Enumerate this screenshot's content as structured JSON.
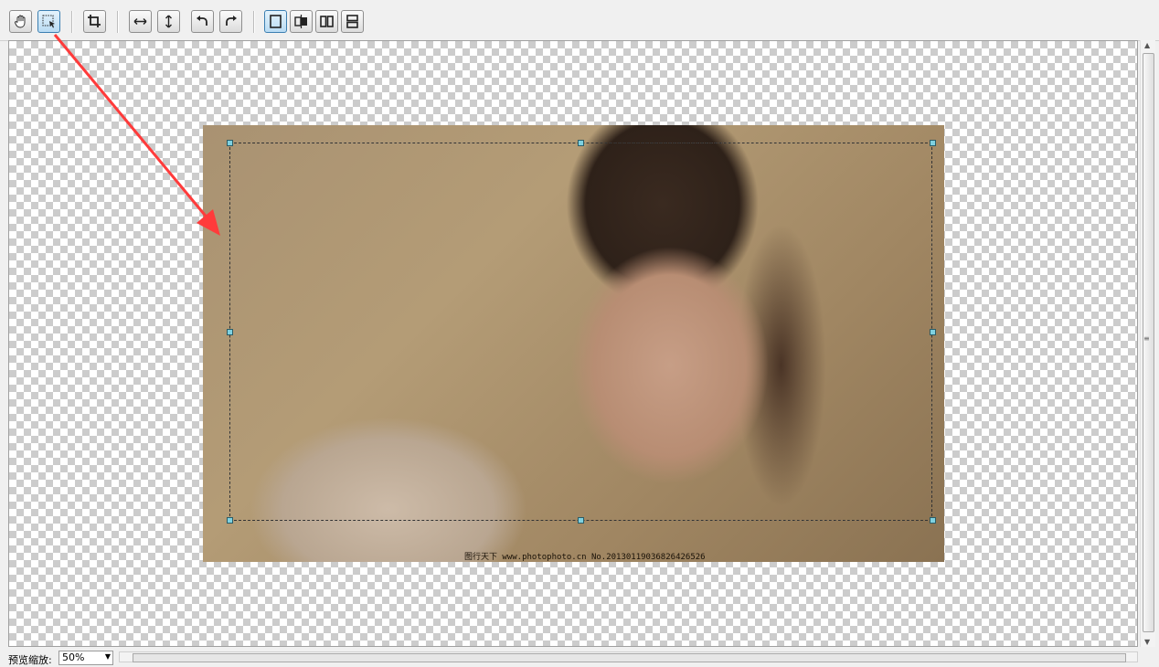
{
  "toolbar": {
    "buttons": [
      {
        "name": "hand-tool",
        "icon": "hand-icon",
        "active": false
      },
      {
        "name": "select-tool",
        "icon": "selection-icon",
        "active": true
      },
      {
        "name": "crop",
        "icon": "crop-icon",
        "active": false
      },
      {
        "name": "flip-horizontal",
        "icon": "flip-horizontal-icon",
        "active": false
      },
      {
        "name": "flip-vertical",
        "icon": "flip-vertical-icon",
        "active": false
      },
      {
        "name": "rotate-left",
        "icon": "rotate-left-icon",
        "active": false
      },
      {
        "name": "rotate-right",
        "icon": "rotate-right-icon",
        "active": false
      },
      {
        "name": "view-single",
        "icon": "single-view-icon",
        "active": true
      },
      {
        "name": "view-compare",
        "icon": "compare-view-icon",
        "active": false
      },
      {
        "name": "view-side-by-side",
        "icon": "side-by-side-icon",
        "active": false
      },
      {
        "name": "view-stacked",
        "icon": "stacked-view-icon",
        "active": false
      }
    ]
  },
  "canvas": {
    "watermark": "图行天下 www.photophoto.cn No.20130119036826426526",
    "annotation_color": "#ff3b3b"
  },
  "status": {
    "zoom_label": "预览缩放:",
    "zoom_value": "50%"
  }
}
